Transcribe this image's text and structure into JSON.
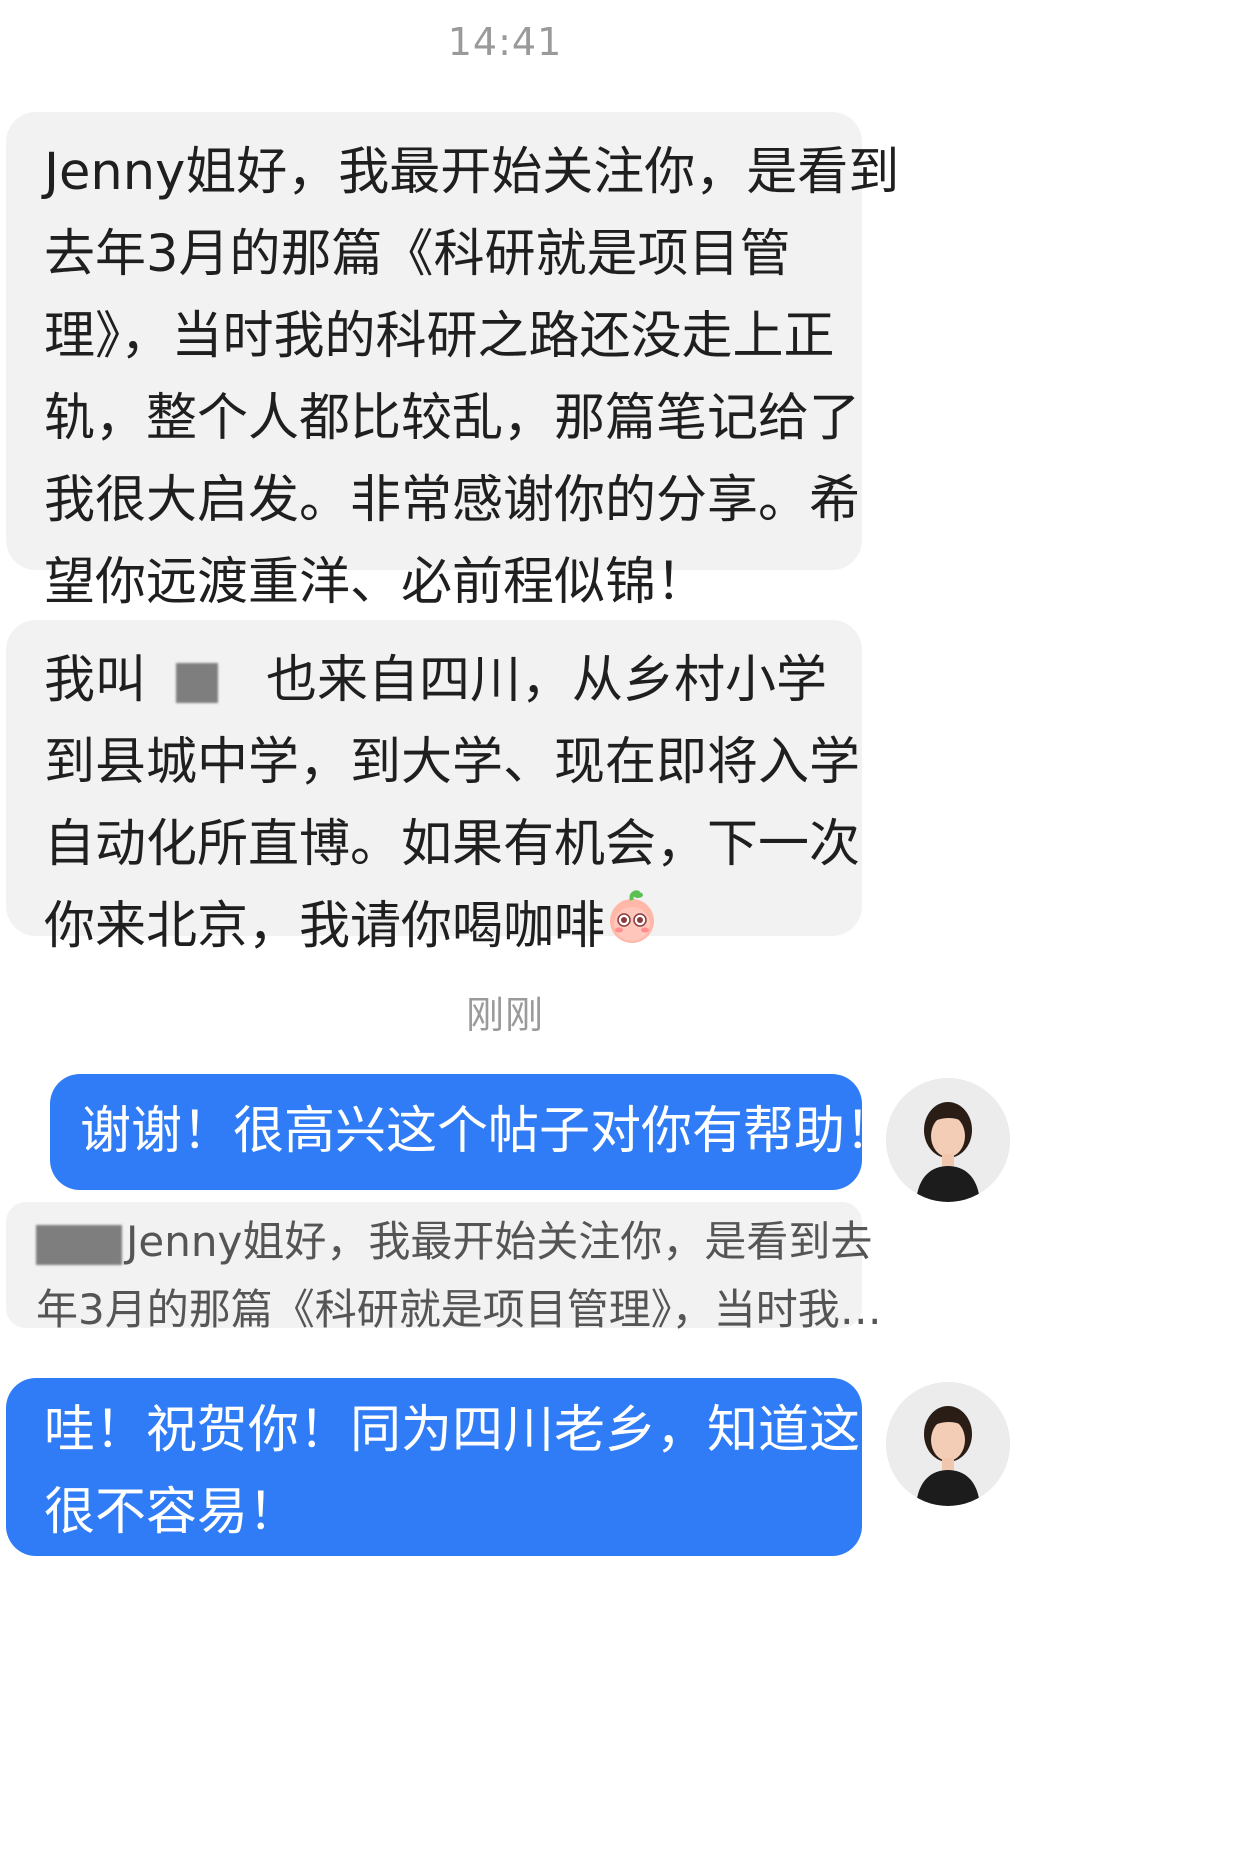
{
  "timestamps": {
    "first": "14:41",
    "second": "刚刚"
  },
  "messages": {
    "incoming_1": {
      "lines": [
        "Jenny姐好，我最开始关注你，是看到",
        "去年3月的那篇《科研就是项目管",
        "理》，当时我的科研之路还没走上正",
        "轨，整个人都比较乱，那篇笔记给了",
        "我很大启发。非常感谢你的分享。希",
        "望你远渡重洋、必前程似锦！"
      ]
    },
    "incoming_2": {
      "line1_before": "我叫",
      "line1_after": "也来自四川，从乡村小学",
      "lines": [
        "到县城中学，到大学、现在即将入学",
        "自动化所直博。如果有机会，下一次"
      ],
      "last_line": "你来北京，我请你喝咖啡",
      "emoji": "peach-character-emoji"
    },
    "outgoing_1": {
      "text": "谢谢！很高兴这个帖子对你有帮助！"
    },
    "quote": {
      "line1": "Jenny姐好，我最开始关注你，是看到去",
      "line2": "年3月的那篇《科研就是项目管理》，当时我…"
    },
    "outgoing_2": {
      "lines": [
        "哇！祝贺你！同为四川老乡，知道这",
        "很不容易！"
      ]
    }
  },
  "avatars": {
    "self": "user-avatar"
  },
  "colors": {
    "outgoing": "#2f7cf6",
    "incoming": "#f2f2f2",
    "timestamp": "#9a9a9a"
  }
}
